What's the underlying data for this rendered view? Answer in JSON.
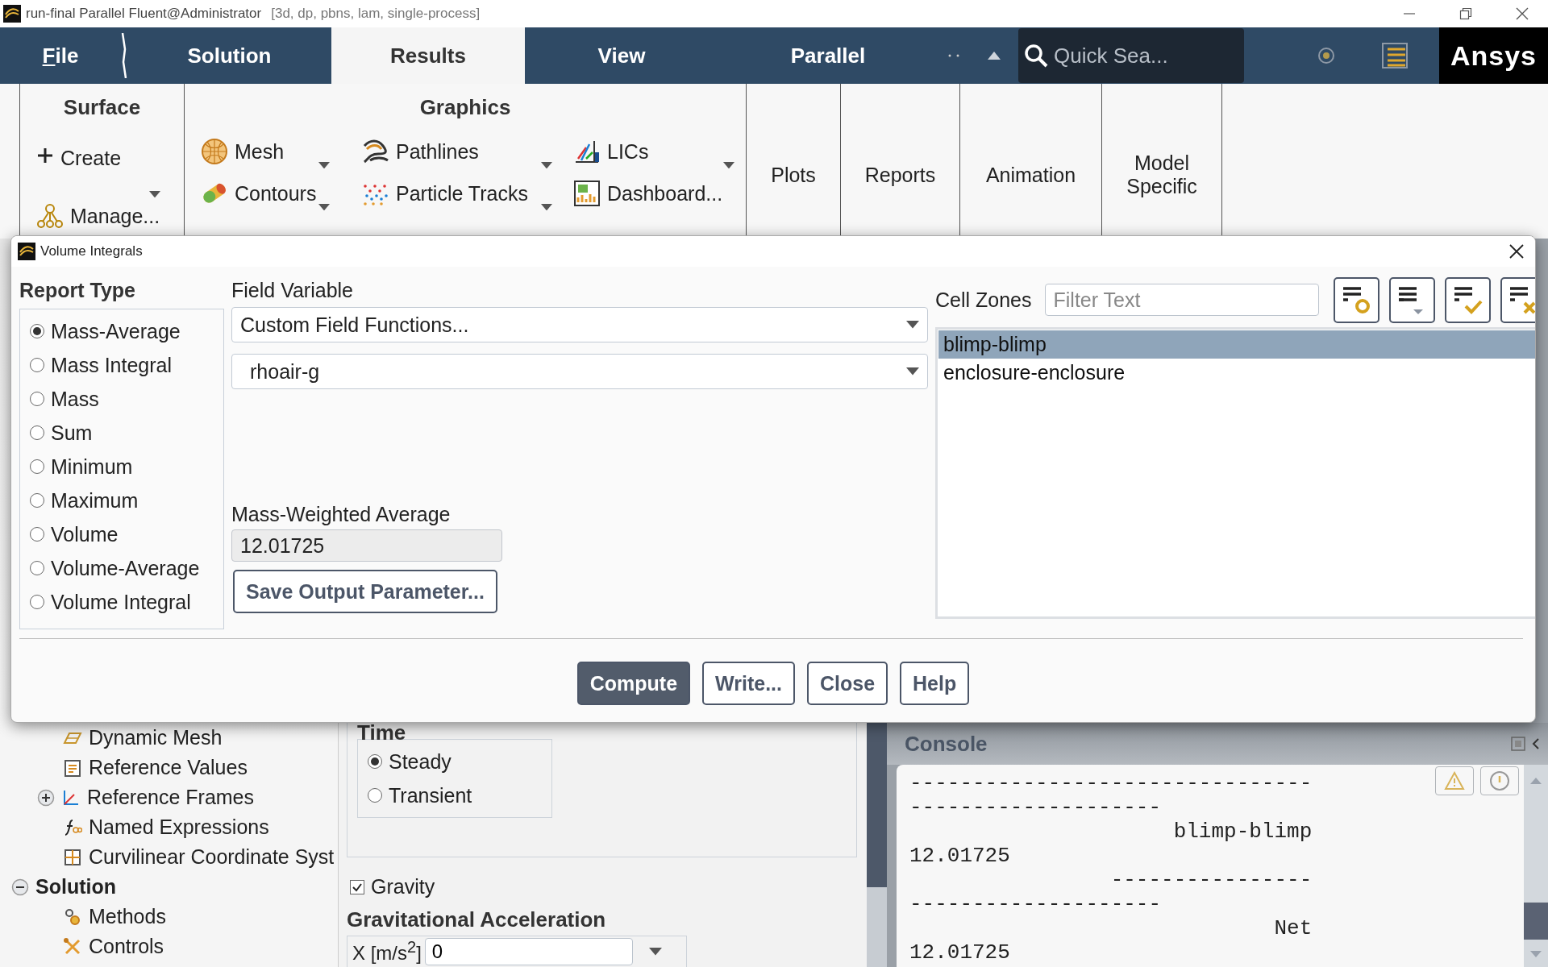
{
  "title_bar": {
    "title": "run-final Parallel Fluent@Administrator",
    "subtitle": "[3d, dp, pbns, lam, single-process]"
  },
  "tabs": [
    {
      "label": "File",
      "selected": false
    },
    {
      "label": "Solution",
      "selected": false
    },
    {
      "label": "Results",
      "selected": true
    },
    {
      "label": "View",
      "selected": false
    },
    {
      "label": "Parallel",
      "selected": false
    }
  ],
  "search": {
    "placeholder": "Quick Sea..."
  },
  "logo": "Ansys",
  "ribbon": {
    "surface": {
      "title": "Surface",
      "items": [
        {
          "label": "Create",
          "kind": "create",
          "dropdown": true
        },
        {
          "label": "Manage...",
          "kind": "manage",
          "dropdown": false
        }
      ]
    },
    "graphics": {
      "title": "Graphics",
      "items": [
        {
          "label": "Mesh",
          "kind": "mesh",
          "dropdown": true
        },
        {
          "label": "Pathlines",
          "kind": "pathlines",
          "dropdown": true
        },
        {
          "label": "LICs",
          "kind": "lics",
          "dropdown": true
        },
        {
          "label": "Contours",
          "kind": "contours",
          "dropdown": true
        },
        {
          "label": "Particle Tracks",
          "kind": "particles",
          "dropdown": true
        },
        {
          "label": "Dashboard...",
          "kind": "dashboard",
          "dropdown": false
        }
      ]
    },
    "buttons": [
      "Plots",
      "Reports",
      "Animation",
      "Model Specific"
    ]
  },
  "dialog": {
    "title": "Volume Integrals",
    "report_type": {
      "label": "Report Type",
      "options": [
        {
          "label": "Mass-Average",
          "selected": true
        },
        {
          "label": "Mass Integral",
          "selected": false
        },
        {
          "label": "Mass",
          "selected": false
        },
        {
          "label": "Sum",
          "selected": false
        },
        {
          "label": "Minimum",
          "selected": false
        },
        {
          "label": "Maximum",
          "selected": false
        },
        {
          "label": "Volume",
          "selected": false
        },
        {
          "label": "Volume-Average",
          "selected": false
        },
        {
          "label": "Volume Integral",
          "selected": false
        }
      ]
    },
    "field_variable": {
      "label": "Field Variable",
      "category": "Custom Field Functions...",
      "variable": "rhoair-g"
    },
    "result": {
      "label": "Mass-Weighted Average",
      "value": "12.01725"
    },
    "save_button": "Save Output Parameter...",
    "cell_zones": {
      "label": "Cell Zones",
      "filter_placeholder": "Filter Text",
      "items": [
        {
          "label": "blimp-blimp",
          "selected": true
        },
        {
          "label": "enclosure-enclosure",
          "selected": false
        }
      ]
    },
    "actions": [
      {
        "label": "Compute",
        "kind": "primary"
      },
      {
        "label": "Write...",
        "kind": "normal"
      },
      {
        "label": "Close",
        "kind": "normal"
      },
      {
        "label": "Help",
        "kind": "normal"
      }
    ]
  },
  "tree": {
    "setup_children": [
      {
        "label": "Dynamic Mesh",
        "kind": "dynamic-mesh"
      },
      {
        "label": "Reference Values",
        "kind": "reference-values"
      },
      {
        "label": "Reference Frames",
        "kind": "reference-frames",
        "expanded": false
      },
      {
        "label": "Named Expressions",
        "kind": "named-expressions"
      },
      {
        "label": "Curvilinear Coordinate Syst",
        "kind": "curvilinear"
      }
    ],
    "sections": [
      {
        "label": "Solution",
        "expanded": true,
        "children": [
          {
            "label": "Methods",
            "kind": "methods"
          },
          {
            "label": "Controls",
            "kind": "controls"
          }
        ]
      }
    ]
  },
  "setup_panel": {
    "time": {
      "label": "Time",
      "options": [
        {
          "label": "Steady",
          "selected": true
        },
        {
          "label": "Transient",
          "selected": false
        }
      ]
    },
    "gravity": {
      "label": "Gravity",
      "checked": true
    },
    "gravitational_acceleration": {
      "label": "Gravitational Acceleration",
      "x_label": "X [m/s$^{2}$]",
      "x_value": "0"
    }
  },
  "console": {
    "title": "Console",
    "lines": [
      "--------------------------------",
      "--------------------",
      "                     blimp-blimp",
      "12.01725",
      "                ----------------",
      "--------------------",
      "                             Net",
      "12.01725"
    ]
  }
}
